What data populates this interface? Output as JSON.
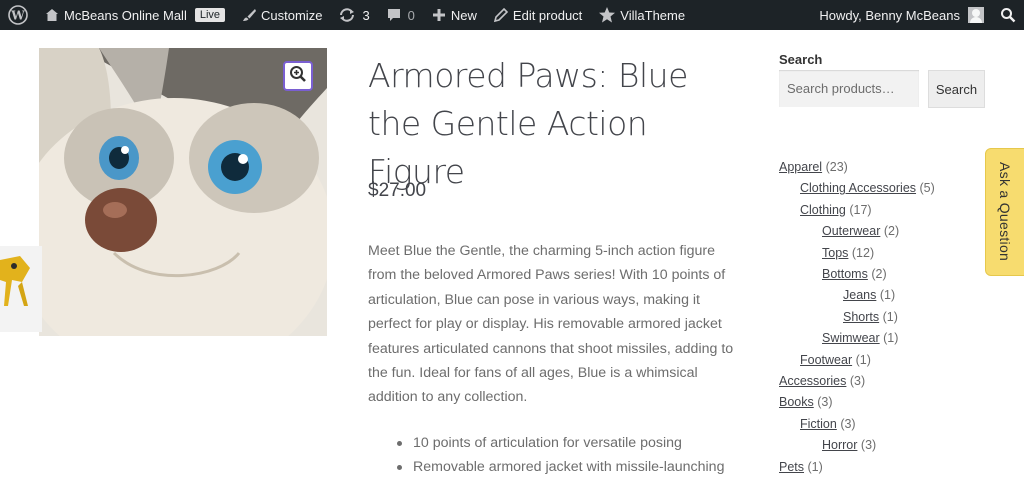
{
  "adminbar": {
    "site_name": "McBeans Online Mall",
    "live_badge": "Live",
    "customize": "Customize",
    "updates_count": "3",
    "comments_count": "0",
    "new": "New",
    "edit_product": "Edit product",
    "villatheme": "VillaTheme",
    "howdy": "Howdy, Benny McBeans"
  },
  "product": {
    "title": "Armored Paws: Blue the Gentle Action Figure",
    "price": "$27.00",
    "description": "Meet Blue the Gentle, the charming 5-inch action figure from the beloved Armored Paws series! With 10 points of articulation, Blue can pose in various ways, making it perfect for play or display. His removable armored jacket features articulated cannons that shoot missiles, adding to the fun. Ideal for fans of all ages, Blue is a whimsical addition to any collection.",
    "features": [
      "10 points of articulation for versatile posing",
      "Removable armored jacket with missile-launching"
    ]
  },
  "sidebar": {
    "search_label": "Search",
    "search_placeholder": "Search products…",
    "search_button": "Search",
    "categories": [
      {
        "name": "Apparel",
        "count": "(23)"
      },
      {
        "name": "Clothing Accessories",
        "count": "(5)"
      },
      {
        "name": "Clothing",
        "count": "(17)"
      },
      {
        "name": "Outerwear",
        "count": "(2)"
      },
      {
        "name": "Tops",
        "count": "(12)"
      },
      {
        "name": "Bottoms",
        "count": "(2)"
      },
      {
        "name": "Jeans",
        "count": "(1)"
      },
      {
        "name": "Shorts",
        "count": "(1)"
      },
      {
        "name": "Swimwear",
        "count": "(1)"
      },
      {
        "name": "Footwear",
        "count": "(1)"
      },
      {
        "name": "Accessories",
        "count": "(3)"
      },
      {
        "name": "Books",
        "count": "(3)"
      },
      {
        "name": "Fiction",
        "count": "(3)"
      },
      {
        "name": "Horror",
        "count": "(3)"
      },
      {
        "name": "Pets",
        "count": "(1)"
      }
    ]
  },
  "ask_tab": "Ask a Question",
  "colors": {
    "adminbar_bg": "#1d2327",
    "ask_tab_bg": "#f7dc6f",
    "zoom_border": "#7a5fd1"
  },
  "icons": [
    "wordpress-icon",
    "brush-icon",
    "updates-icon",
    "comment-icon",
    "plus-icon",
    "pencil-icon",
    "star-icon",
    "search-icon",
    "zoom-icon"
  ]
}
